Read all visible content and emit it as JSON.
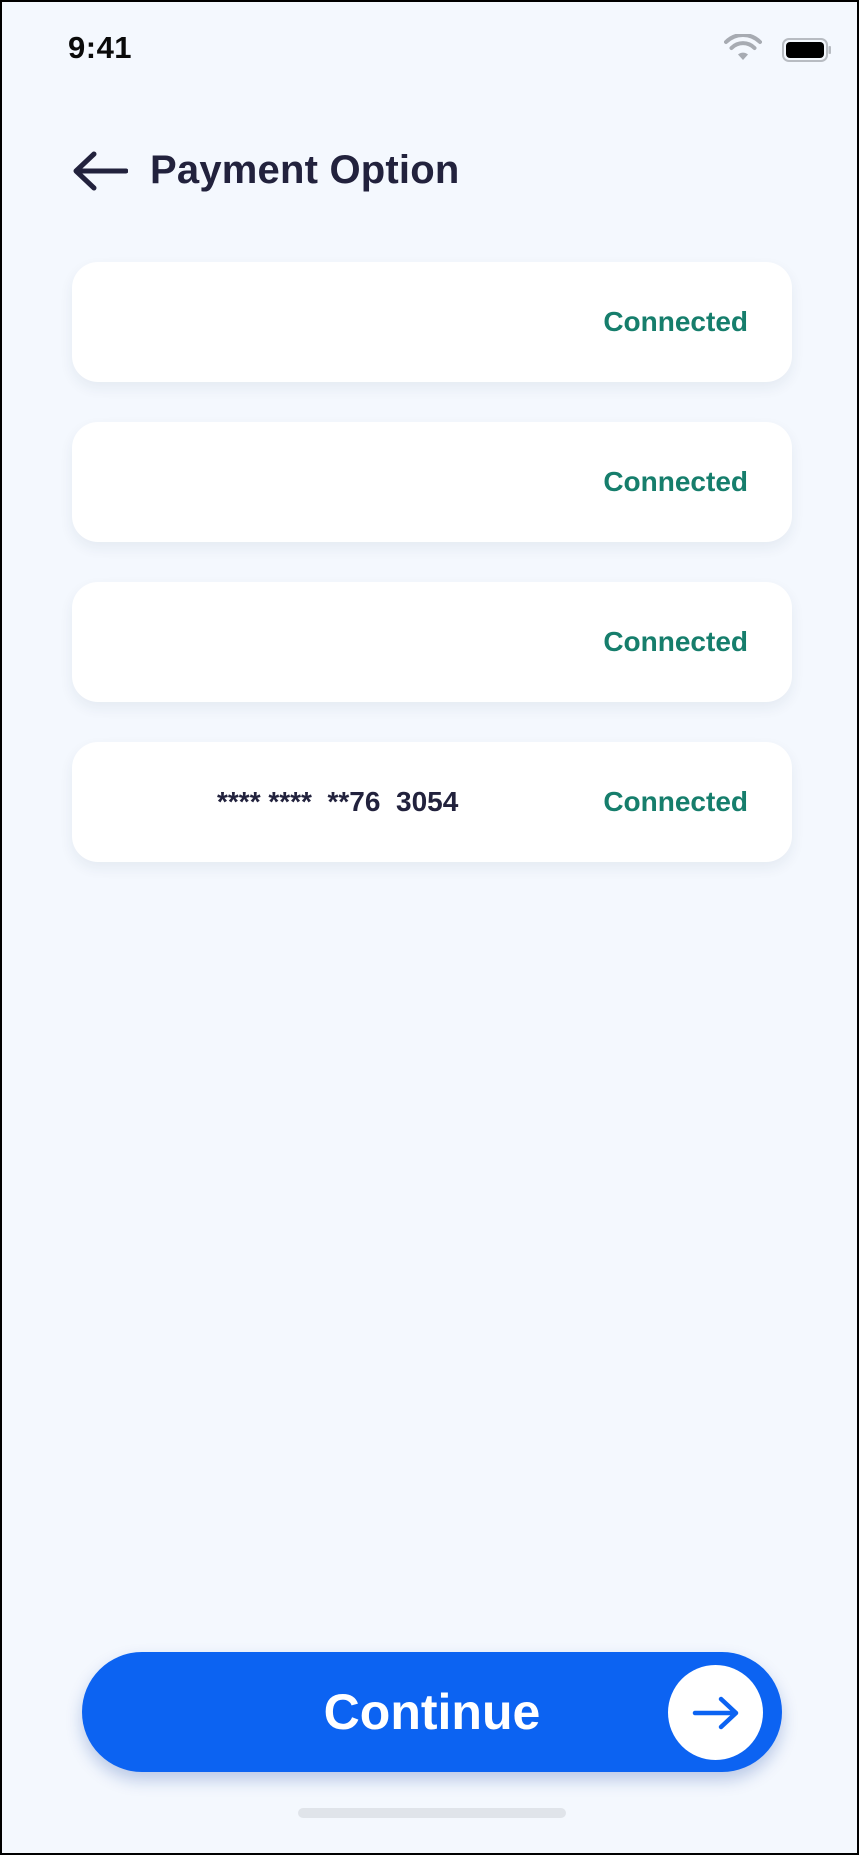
{
  "status_bar": {
    "time": "9:41",
    "icons": [
      "wifi-icon",
      "battery-icon"
    ]
  },
  "header": {
    "back_icon": "arrow-left-icon",
    "title": "Payment Option"
  },
  "payment_options": [
    {
      "number": "",
      "status": "Connected"
    },
    {
      "number": "",
      "status": "Connected"
    },
    {
      "number": "",
      "status": "Connected"
    },
    {
      "number": "**** ****  **76  3054",
      "status": "Connected"
    }
  ],
  "continue_button": {
    "label": "Continue",
    "icon": "arrow-right-icon"
  },
  "colors": {
    "background": "#f4f8fe",
    "title": "#22223d",
    "status_connected": "#167e6c",
    "primary": "#0c63f2"
  }
}
